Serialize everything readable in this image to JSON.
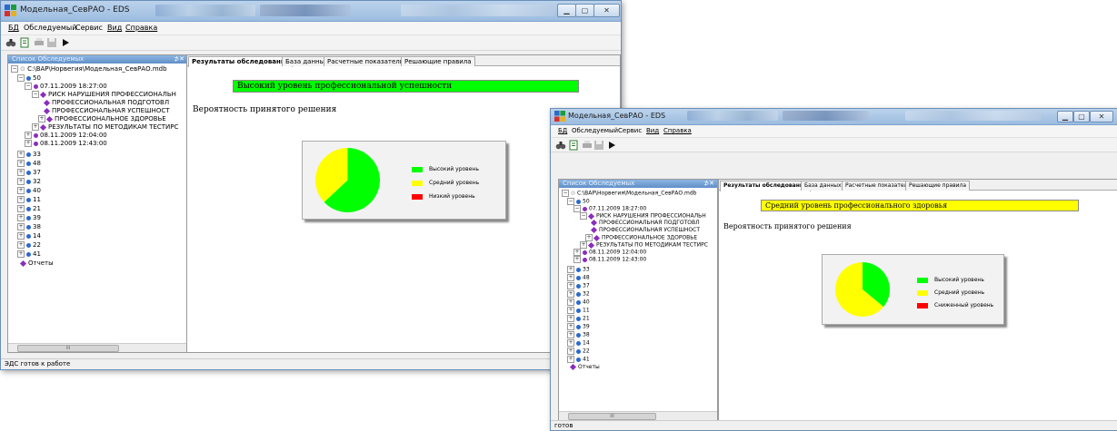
{
  "window1": {
    "title": "Модельная_СевРАО - EDS",
    "menu": [
      "БД",
      "Обследуемый",
      "Сервис",
      "Вид",
      "Справка"
    ],
    "toolbar_icons": [
      "binoculars-icon",
      "document-icon",
      "print-icon",
      "disk-icon",
      "play-icon"
    ],
    "panel_title": "Список Обследуемых",
    "tree": {
      "root": "C:\\BAP\\Норвегия\\Модельная_СевРАО.mdb",
      "subject": "50",
      "date1": "07.11.2009 18:27:00",
      "risk": "РИСК НАРУШЕНИЯ ПРОФЕССИОНАЛЬН",
      "prof_training": "ПРОФЕССИОНАЛЬНАЯ ПОДГОТОВЛ",
      "prof_success": "ПРОФЕССИОНАЛЬНАЯ УСПЕШНОСТ",
      "prof_health": "ПРОФЕССИОНАЛЬНОЕ ЗДОРОВЬЕ",
      "results": "РЕЗУЛЬТАТЫ ПО МЕТОДИКАМ ТЕСТИРС",
      "date2": "08.11.2009 12:04:00",
      "date3": "08.11.2009 12:43:00",
      "subjects": [
        "33",
        "48",
        "37",
        "32",
        "40",
        "11",
        "21",
        "39",
        "38",
        "14",
        "22",
        "41"
      ],
      "reports": "Отчеты"
    },
    "tabs": [
      "Результаты обследования",
      "База данных",
      "Расчетные показатели",
      "Решающие правила"
    ],
    "result_text": "Высокий уровень профессиональной успешности",
    "result_color": "#00ff00",
    "probability_label": "Вероятность принятого решения",
    "chart_data": {
      "type": "pie",
      "slices": [
        {
          "label": "Высокий уровень",
          "value": 63,
          "color": "#00ff00"
        },
        {
          "label": "Средний уровень",
          "value": 37,
          "color": "#ffff00"
        },
        {
          "label": "Низкий уровень",
          "value": 0,
          "color": "#ff0000"
        }
      ]
    },
    "status": "ЭДС готов к работе"
  },
  "window2": {
    "title": "Модельная_СевРАО - EDS",
    "menu": [
      "БД",
      "Обследуемый",
      "Сервис",
      "Вид",
      "Справка"
    ],
    "toolbar_icons": [
      "binoculars-icon",
      "document-icon",
      "print-icon",
      "disk-icon",
      "play-icon"
    ],
    "panel_title": "Список Обследуемых",
    "tree": {
      "root": "C:\\BAP\\Норвегия\\Модельная_СевРАО.mdb",
      "subject": "50",
      "date1": "07.11.2009 18:27:00",
      "risk": "РИСК НАРУШЕНИЯ ПРОФЕССИОНАЛЬН",
      "prof_training": "ПРОФЕССИОНАЛЬНАЯ ПОДГОТОВЛ",
      "prof_success": "ПРОФЕССИОНАЛЬНАЯ УСПЕШНОСТ",
      "prof_health": "ПРОФЕССИОНАЛЬНОЕ ЗДОРОВЬЕ",
      "results": "РЕЗУЛЬТАТЫ ПО МЕТОДИКАМ ТЕСТИРС",
      "date2": "08.11.2009 12:04:00",
      "date3": "08.11.2009 12:43:00",
      "subjects": [
        "33",
        "48",
        "37",
        "32",
        "40",
        "11",
        "21",
        "39",
        "38",
        "14",
        "22",
        "41"
      ],
      "reports": "Отчеты"
    },
    "tabs": [
      "Результаты обследования",
      "База данных",
      "Расчетные показатели",
      "Решающие правила"
    ],
    "result_text": "Средний уровень профессионального здоровья",
    "result_color": "#ffff00",
    "probability_label": "Вероятность принятого решения",
    "chart_data": {
      "type": "pie",
      "slices": [
        {
          "label": "Высокий уровень",
          "value": 36,
          "color": "#00ff00"
        },
        {
          "label": "Средний уровень",
          "value": 64,
          "color": "#ffff00"
        },
        {
          "label": "Сниженный уровень",
          "value": 0,
          "color": "#ff0000"
        }
      ]
    },
    "status": "готов"
  }
}
